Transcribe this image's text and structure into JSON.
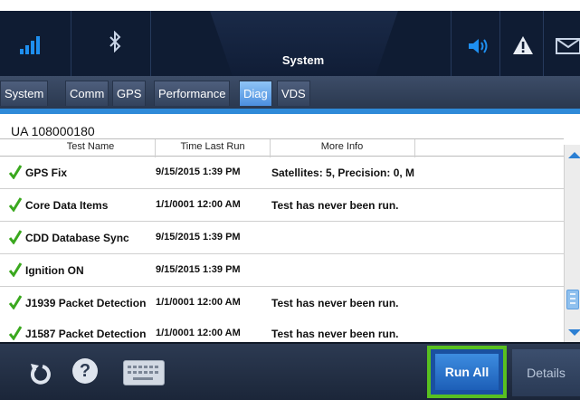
{
  "header": {
    "title": "System",
    "icons": [
      "signal-bars-icon",
      "bluetooth-icon",
      "speaker-icon",
      "warning-icon",
      "mail-icon"
    ]
  },
  "tabs": [
    {
      "label": "System",
      "active": false
    },
    {
      "label": "Comm",
      "active": false
    },
    {
      "label": "GPS",
      "active": false
    },
    {
      "label": "Performance",
      "active": false
    },
    {
      "label": "Diag",
      "active": true
    },
    {
      "label": "VDS",
      "active": false
    }
  ],
  "unit_id": "UA 108000180",
  "table": {
    "columns": [
      "Test Name",
      "Time Last Run",
      "More Info"
    ],
    "rows": [
      {
        "status": "pass",
        "name": "GPS Fix",
        "time": "9/15/2015 1:39 PM",
        "info": "Satellites: 5, Precision: 0, M"
      },
      {
        "status": "pass",
        "name": "Core Data Items",
        "time": "1/1/0001 12:00 AM",
        "info": "Test has never been run."
      },
      {
        "status": "pass",
        "name": "CDD Database Sync",
        "time": "9/15/2015 1:39 PM",
        "info": ""
      },
      {
        "status": "pass",
        "name": "Ignition ON",
        "time": "9/15/2015 1:39 PM",
        "info": ""
      },
      {
        "status": "pass",
        "name": "J1939 Packet Detection",
        "time": "1/1/0001 12:00 AM",
        "info": "Test has never been run."
      },
      {
        "status": "pass",
        "name": "J1587 Packet Detection",
        "time": "1/1/0001 12:00 AM",
        "info": "Test has never been run."
      }
    ]
  },
  "footer": {
    "icons": [
      "refresh-icon",
      "help-icon",
      "keyboard-icon"
    ],
    "run_all_label": "Run All",
    "details_label": "Details"
  },
  "colors": {
    "accent": "#2f8ad8",
    "check": "#3aa81e",
    "highlight": "#58c020",
    "header_bg": "#0f1c33"
  }
}
